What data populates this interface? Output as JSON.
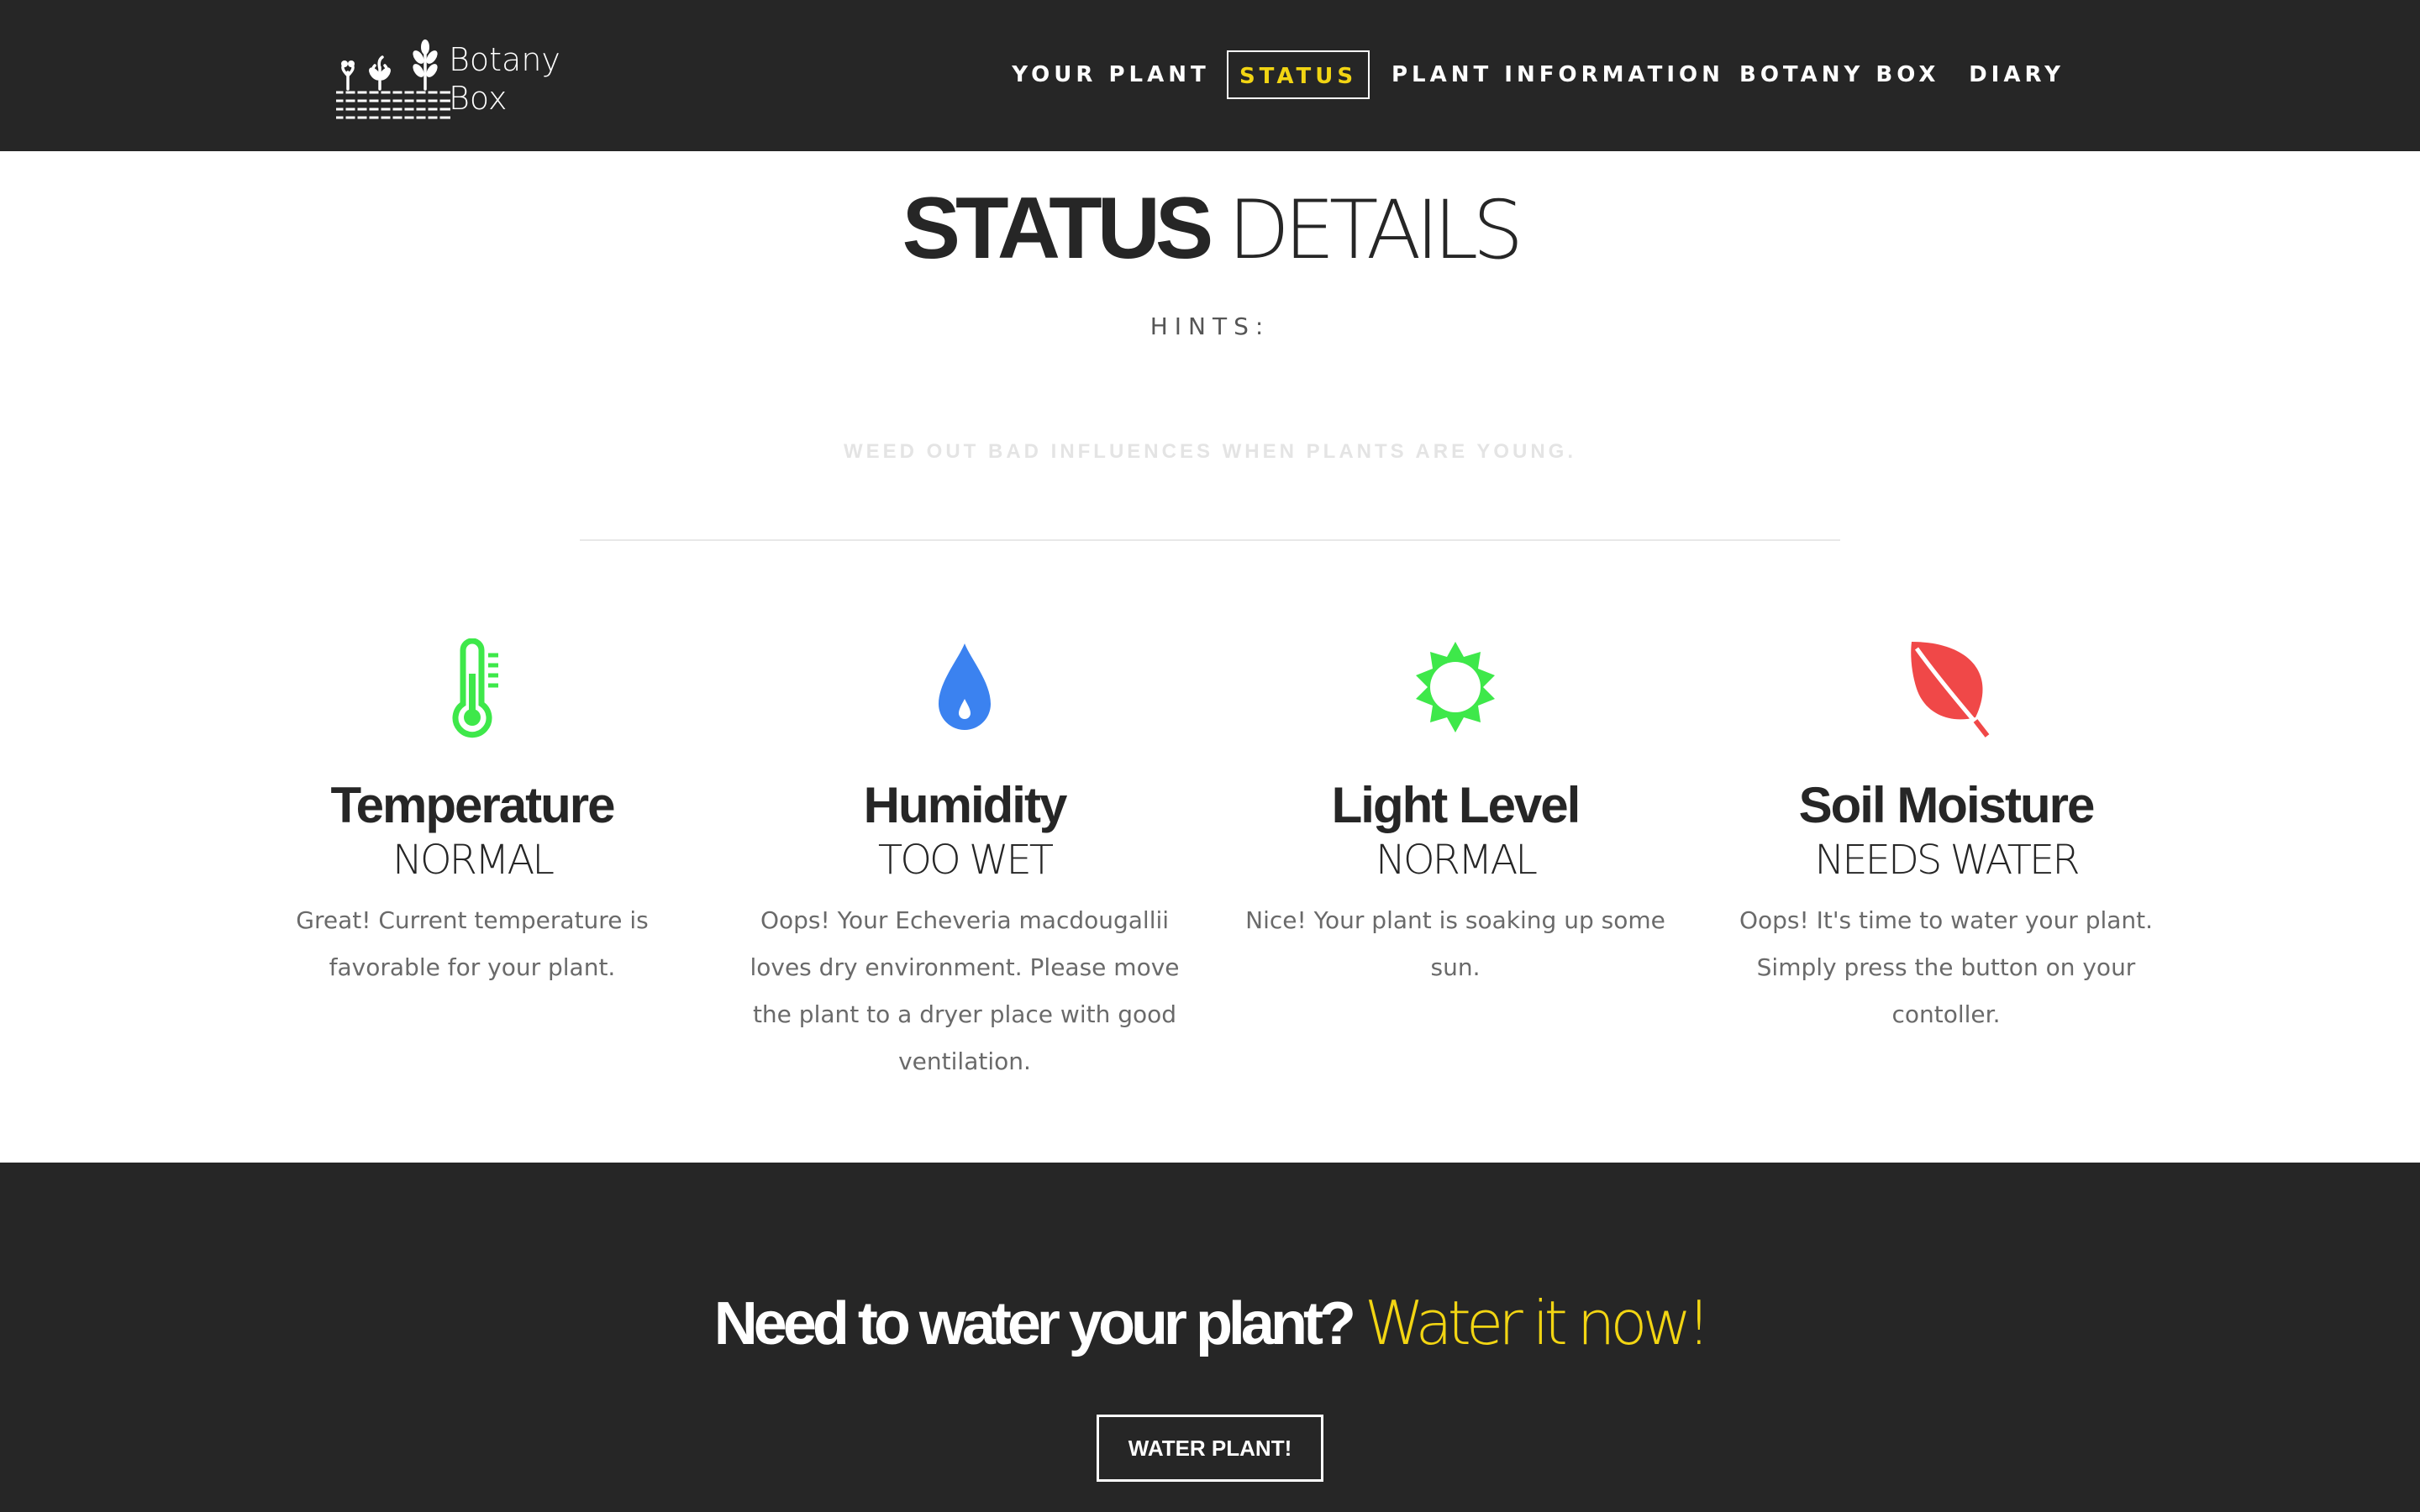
{
  "brand": {
    "line1": "Botany",
    "line2": "Box"
  },
  "nav": {
    "items": [
      {
        "label": "YOUR PLANT"
      },
      {
        "label": "STATUS",
        "active": true
      },
      {
        "label": "PLANT INFORMATION"
      },
      {
        "label": "BOTANY BOX"
      },
      {
        "label": "DIARY"
      }
    ]
  },
  "status": {
    "title_bold": "STATUS",
    "title_light": "DETAILS",
    "hints_label": "HINTS:",
    "hint_text": "WEED OUT BAD INFLUENCES WHEN PLANTS ARE YOUNG."
  },
  "cards": [
    {
      "name": "Temperature",
      "value": "NORMAL",
      "description": "Great! Current temperature is favorable for your plant.",
      "icon": "thermometer-icon",
      "color": "#3ee84a"
    },
    {
      "name": "Humidity",
      "value": "TOO WET",
      "description": "Oops! Your Echeveria macdougallii loves dry environment. Please move the plant to a dryer place with good ventilation.",
      "icon": "water-drop-icon",
      "color": "#3b82f0"
    },
    {
      "name": "Light Level",
      "value": "NORMAL",
      "description": "Nice! Your plant is soaking up some sun.",
      "icon": "sun-icon",
      "color": "#3ee84a"
    },
    {
      "name": "Soil Moisture",
      "value": "NEEDS WATER",
      "description": "Oops! It's time to water your plant. Simply press the button on your contoller.",
      "icon": "leaf-icon",
      "color": "#f04848"
    }
  ],
  "cta": {
    "question": "Need to water your plant?",
    "answer": "Water it now!",
    "button_label": "WATER PLANT!"
  },
  "colors": {
    "dark": "#262626",
    "accent": "#f2d513"
  }
}
